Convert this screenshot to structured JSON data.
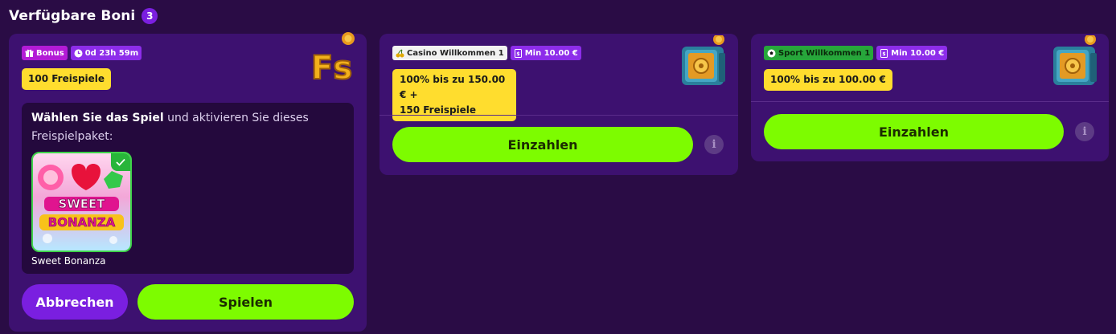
{
  "header": {
    "title": "Verfügbare Boni",
    "count": "3"
  },
  "card1": {
    "tags": {
      "bonus": "Bonus",
      "timer": "0d 23h 59m"
    },
    "label": "100 Freispiele",
    "instruction_bold": "Wählen Sie das Spiel",
    "instruction_rest": " und aktivieren Sie dieses Freispielpaket:",
    "game": {
      "name": "Sweet Bonanza",
      "tile_line1": "SWEET",
      "tile_line2": "BONANZA"
    },
    "buttons": {
      "cancel": "Abbrechen",
      "play": "Spielen"
    }
  },
  "card2": {
    "tags": {
      "type": "Casino Willkommen 1",
      "min": "Min 10.00 €"
    },
    "label_line1": "100% bis zu 150.00 € +",
    "label_line2": "150 Freispiele",
    "button": "Einzahlen"
  },
  "card3": {
    "tags": {
      "type": "Sport Willkommen 1",
      "min": "Min 10.00 €"
    },
    "label": "100% bis zu 100.00 €",
    "button": "Einzahlen"
  },
  "icons": {
    "info": "i",
    "fs": "Fs"
  },
  "colors": {
    "background": "#2a0c45",
    "card": "#3d1170",
    "accent_green": "#7dfc00",
    "accent_purple": "#7a1fe0",
    "label_yellow": "#ffdd2e"
  }
}
